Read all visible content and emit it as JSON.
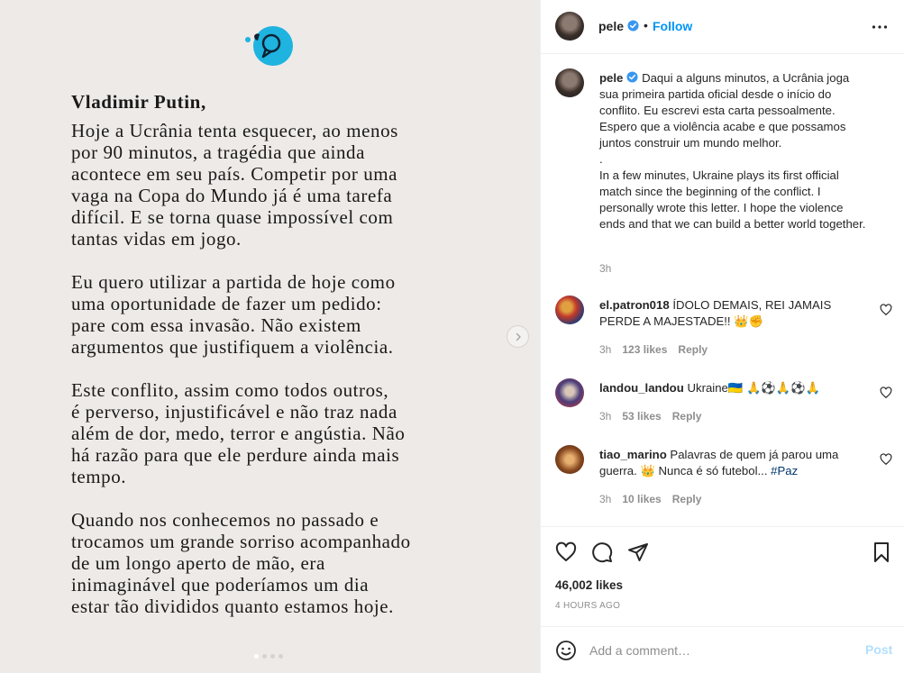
{
  "post": {
    "letter": {
      "greeting": "Vladimir Putin,",
      "paragraphs": [
        "Hoje a Ucrânia tenta esquecer, ao menos\npor 90 minutos, a tragédia que ainda\nacontece em seu país. Competir por uma\nvaga na Copa do Mundo já é uma tarefa\ndifícil. E se torna quase impossível com\ntantas vidas em jogo.",
        "Eu quero utilizar a partida de hoje como\numa oportunidade de fazer um pedido:\npare com essa invasão. Não existem\nargumentos que justifiquem a violência.",
        "Este conflito, assim como todos outros,\né perverso, injustificável e não traz nada\nalém de dor, medo, terror e angústia. Não\nhá razão para que ele perdure ainda mais\ntempo.",
        "Quando nos conhecemos no passado e\ntrocamos um grande sorriso acompanhado\nde um longo aperto de mão, era\ninimaginável que poderíamos um dia\nestar tão divididos quanto estamos hoje."
      ]
    },
    "carousel": {
      "total": 4,
      "current": 1
    },
    "colors": {
      "logo": "#1fb3e0",
      "follow": "#0095f6",
      "verified": "#3897f0"
    }
  },
  "header": {
    "username": "pele",
    "separator": "•",
    "follow_label": "Follow",
    "more_icon": "more-horizontal-icon"
  },
  "caption": {
    "username": "pele",
    "text": "Daqui a alguns minutos, a Ucrânia joga sua primeira partida oficial desde o início do conflito. Eu escrevi esta carta pessoalmente. Espero que a violência acabe e que possamos juntos construir um mundo melhor.\n.\nIn a few minutes, Ukraine plays its first official match since the beginning of the conflict. I personally wrote this letter. I hope the violence ends and that we can build a better world together.",
    "time": "3h"
  },
  "comments": [
    {
      "username": "el.patron018",
      "text": "ÍDOLO DEMAIS, REI JAMAIS PERDE A MAJESTADE!! 👑✊",
      "time": "3h",
      "likes": "123 likes",
      "reply": "Reply"
    },
    {
      "username": "landou_landou",
      "text": "Ukraine🇺🇦 🙏⚽🙏⚽🙏",
      "time": "3h",
      "likes": "53 likes",
      "reply": "Reply"
    },
    {
      "username": "tiao_marino",
      "text": "Palavras de quem já parou uma guerra. 👑 Nunca é só futebol...",
      "hashtag": "#Paz",
      "time": "3h",
      "likes": "10 likes",
      "reply": "Reply"
    }
  ],
  "actions": {
    "likes": "46,002 likes",
    "time": "4 HOURS AGO"
  },
  "add_comment": {
    "placeholder": "Add a comment…",
    "post_label": "Post"
  }
}
